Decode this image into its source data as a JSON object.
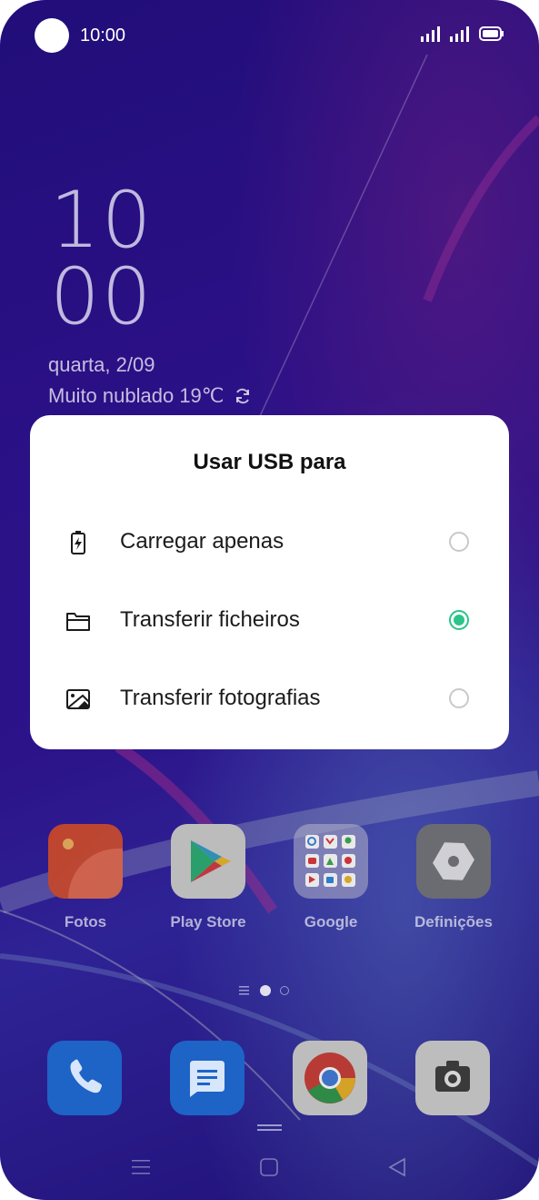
{
  "status_bar": {
    "time": "10:00",
    "icons": [
      "profile-circle",
      "signal-icon",
      "signal-icon",
      "battery-icon"
    ]
  },
  "lock_clock": {
    "hours": "10",
    "minutes": "00",
    "date": "quarta, 2/09",
    "weather": "Muito nublado 19℃",
    "refresh_icon": "refresh-icon"
  },
  "dialog": {
    "title": "Usar USB para",
    "options": [
      {
        "label": "Carregar apenas",
        "icon": "battery-charging-icon",
        "selected": false
      },
      {
        "label": "Transferir ficheiros",
        "icon": "folder-icon",
        "selected": true
      },
      {
        "label": "Transferir fotografias",
        "icon": "photo-icon",
        "selected": false
      }
    ],
    "accent_color": "#2bc48a"
  },
  "home_apps": [
    {
      "name": "Fotos",
      "icon": "photos-icon"
    },
    {
      "name": "Play Store",
      "icon": "play-store-icon"
    },
    {
      "name": "Google",
      "icon": "google-folder-icon"
    },
    {
      "name": "Definições",
      "icon": "settings-icon"
    }
  ],
  "page_indicator": {
    "pages": 2,
    "current": 1
  },
  "dock": [
    "phone-icon",
    "messages-icon",
    "chrome-icon",
    "camera-icon"
  ],
  "nav_bar": [
    "menu-icon",
    "home-icon",
    "back-icon"
  ]
}
